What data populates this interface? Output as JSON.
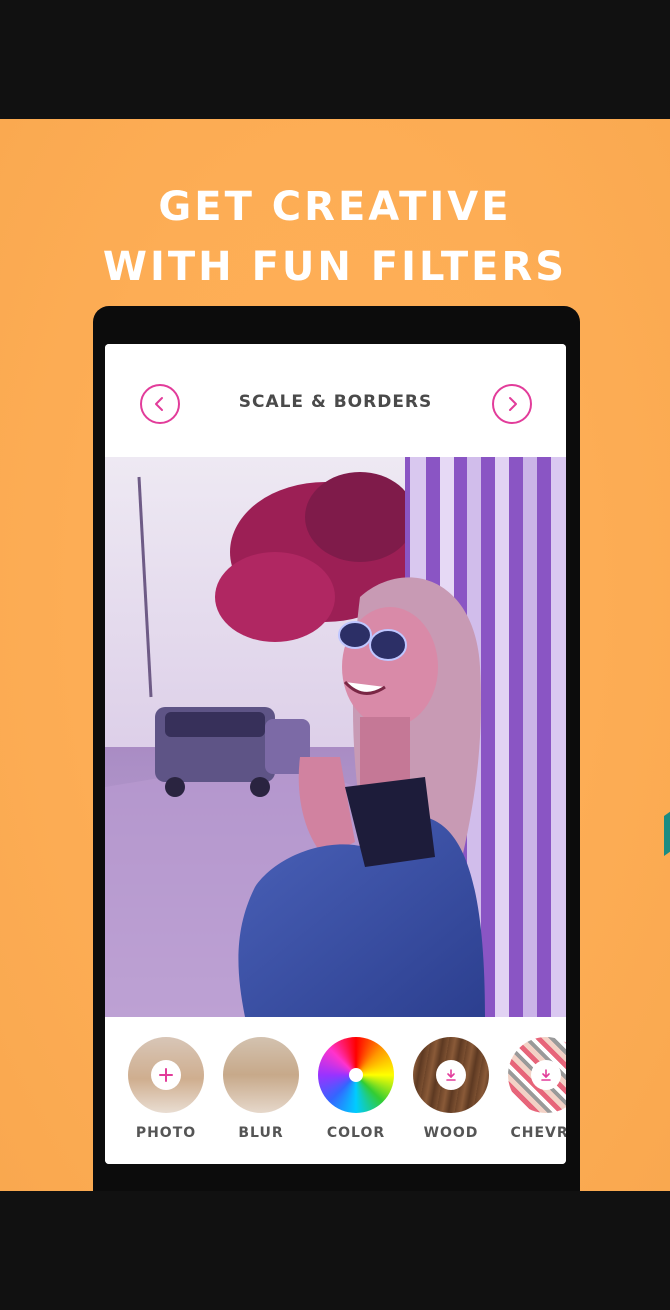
{
  "headline": {
    "line1": "GET CREATIVE",
    "line2": "WITH FUN FILTERS"
  },
  "screen": {
    "title": "SCALE & BORDERS",
    "prev_icon": "chevron-left-icon",
    "next_icon": "chevron-right-icon"
  },
  "filters": [
    {
      "label": "PHOTO",
      "icon": "plus-icon"
    },
    {
      "label": "BLUR",
      "icon": ""
    },
    {
      "label": "COLOR",
      "icon": ""
    },
    {
      "label": "WOOD",
      "icon": "download-icon"
    },
    {
      "label": "CHEVRO",
      "icon": "download-icon"
    }
  ],
  "colors": {
    "background": "#fdad55",
    "accent": "#e23c9a",
    "headline": "#ffffff",
    "frame": "#111111"
  }
}
